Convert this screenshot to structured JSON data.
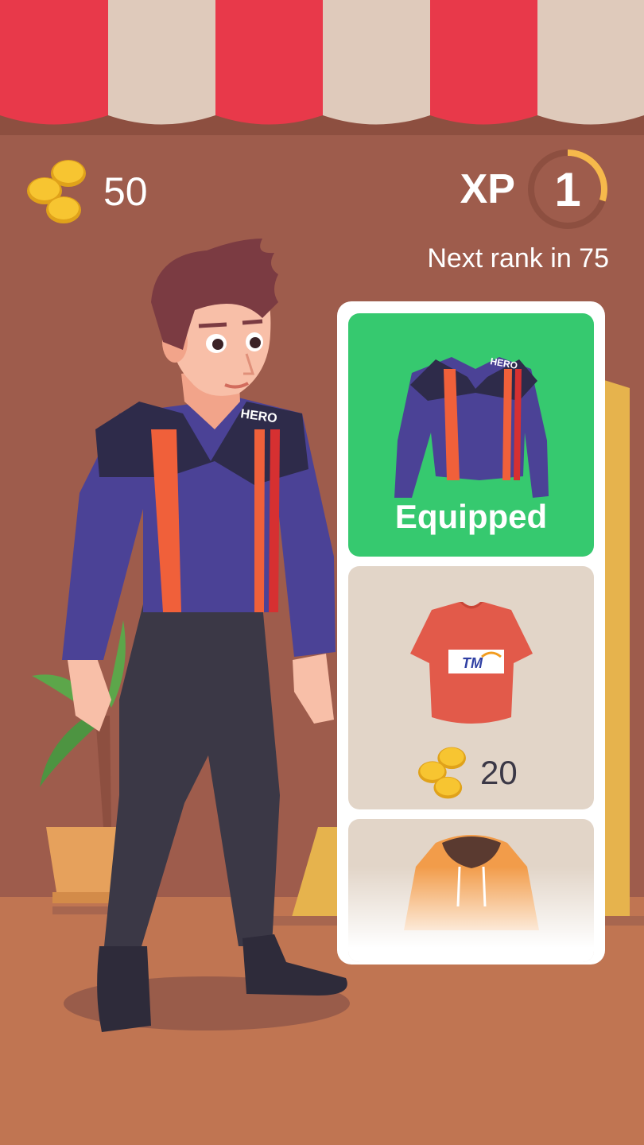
{
  "hud": {
    "coins": "50",
    "xp_label": "XP",
    "xp_level": "1",
    "xp_progress": 0.3,
    "next_rank_text": "Next rank in 75"
  },
  "shop": {
    "items": [
      {
        "name": "HERO racing jacket",
        "status": "Equipped",
        "icon": "jacket-icon"
      },
      {
        "name": "TM t-shirt",
        "price": "20",
        "icon": "tshirt-icon"
      },
      {
        "name": "hoodie",
        "icon": "hoodie-icon"
      }
    ]
  },
  "colors": {
    "awning_red": "#e8394a",
    "awning_cream": "#dfcabb",
    "wall": "#9e5c4c",
    "floor": "#c07552",
    "equipped_green": "#36c96f",
    "card_beige": "#e2d5c8",
    "xp_ring": "#f6b94b"
  },
  "icons": {
    "coin": "coin-stack-icon",
    "jacket_logo": "HERO",
    "tshirt_logo": "TM"
  }
}
